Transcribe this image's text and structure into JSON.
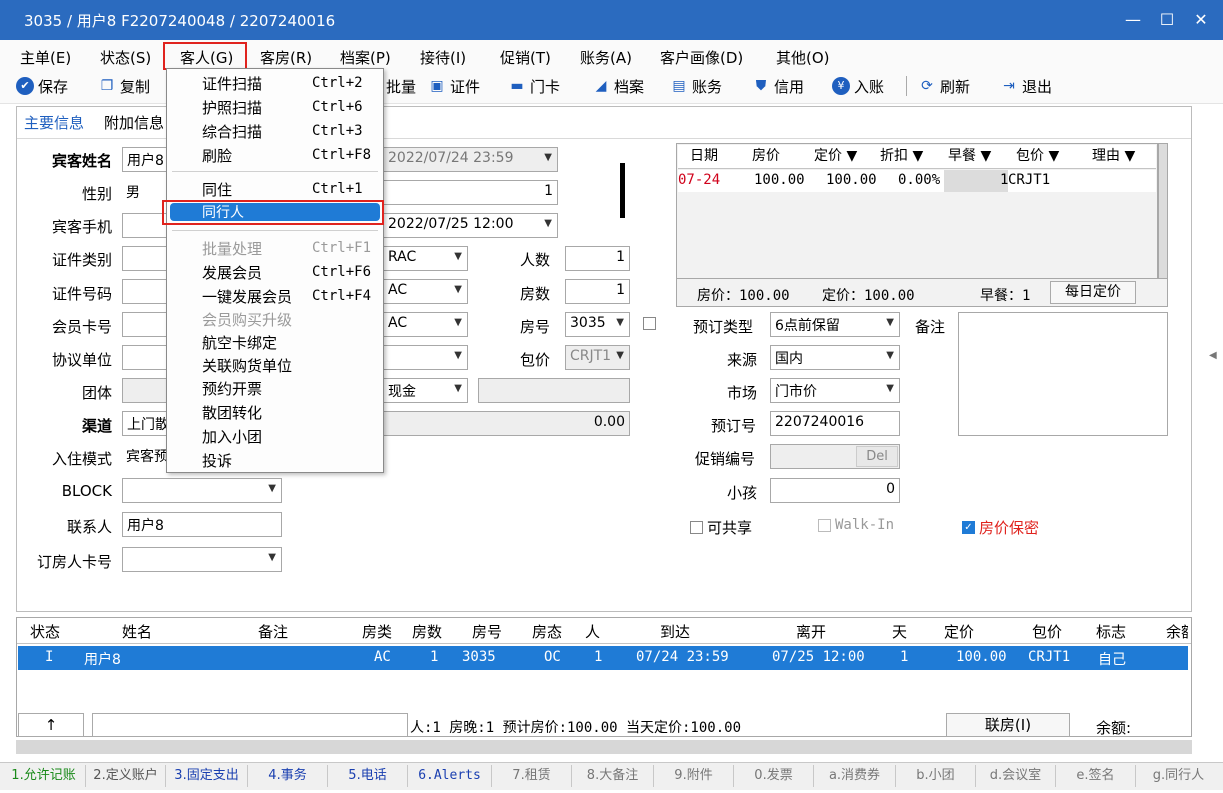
{
  "window": {
    "title": "3035 / 用户8 F2207240048 / 2207240016",
    "controls": {
      "minimize": "—",
      "maximize": "☐",
      "close": "✕"
    }
  },
  "menubar": [
    "主单(E)",
    "状态(S)",
    "客人(G)",
    "客房(R)",
    "档案(P)",
    "接待(I)",
    "促销(T)",
    "账务(A)",
    "客户画像(D)",
    "其他(O)"
  ],
  "toolbar": {
    "save": "保存",
    "copy": "复制",
    "batch": "批量",
    "id": "证件",
    "card": "门卡",
    "profile": "档案",
    "account": "账务",
    "credit": "信用",
    "post": "入账",
    "refresh": "刷新",
    "exit": "退出"
  },
  "subtabs": {
    "main": "主要信息",
    "extra": "附加信息"
  },
  "form_left": {
    "guest_name_label": "宾客姓名",
    "guest_name": "用户8",
    "gender_label": "性别",
    "gender": "男",
    "phone_label": "宾客手机",
    "id_type_label": "证件类别",
    "id_no_label": "证件号码",
    "member_label": "会员卡号",
    "agreement_label": "协议单位",
    "group_label": "团体",
    "channel_label": "渠道",
    "channel": "上门散",
    "checkin_mode_label": "入住模式",
    "checkin_mode": "宾客预",
    "block_label": "BLOCK",
    "contact_label": "联系人",
    "contact": "用户8",
    "booker_card_label": "订房人卡号"
  },
  "form_mid": {
    "arrival": "2022/07/24 23:59",
    "nights": "1",
    "departure": "2022/07/25 12:00",
    "rate_code1": "RAC",
    "rate_code2": "AC",
    "rate_code3": "AC",
    "pay_method": "现金",
    "amount": "0.00",
    "persons_label": "人数",
    "persons": "1",
    "rooms_label": "房数",
    "rooms": "1",
    "room_no_label": "房号",
    "room_no": "3035",
    "package_label": "包价",
    "package": "CRJT1"
  },
  "rate_grid": {
    "headers": [
      "日期",
      "房价",
      "定价 ▼",
      "折扣 ▼",
      "早餐 ▼",
      "包价 ▼",
      "理由 ▼"
    ],
    "row": {
      "date": "07-24",
      "price": "100.00",
      "fixed": "100.00",
      "discount": "0.00%",
      "breakfast": "1",
      "package": "CRJT1"
    },
    "summary": {
      "price": "房价：100.00",
      "fixed": "定价：100.00",
      "breakfast": "早餐：1",
      "daily_button": "每日定价"
    }
  },
  "form_right": {
    "booking_type_label": "预订类型",
    "booking_type": "6点前保留",
    "remark_label": "备注",
    "source_label": "来源",
    "source": "国内",
    "market_label": "市场",
    "market": "门市价",
    "booking_no_label": "预订号",
    "booking_no": "2207240016",
    "promo_label": "促销编号",
    "del_button": "Del",
    "children_label": "小孩",
    "children": "0",
    "shareable": "可共享",
    "walkin": "Walk-In",
    "rate_secret": "房价保密"
  },
  "guest_table": {
    "headers": [
      "状态",
      "姓名",
      "备注",
      "房类",
      "房数",
      "房号",
      "房态",
      "人",
      "到达",
      "离开",
      "天",
      "定价",
      "包价",
      "标志",
      "余额"
    ],
    "row": [
      "I",
      "用户8",
      "",
      "AC",
      "1",
      "3035",
      "OC",
      "1",
      "07/24 23:59",
      "07/25 12:00",
      "1",
      "100.00",
      "CRJT1",
      "自己",
      ""
    ],
    "footer": {
      "up": "↑",
      "summary": "人:1  房晚:1  预计房价:100.00  当天定价:100.00",
      "link_room": "联房(I)",
      "balance": "余额:"
    }
  },
  "status_tabs": [
    "1.允许记账",
    "2.定义账户",
    "3.固定支出",
    "4.事务",
    "5.电话",
    "6.Alerts",
    "7.租赁",
    "8.大备注",
    "9.附件",
    "0.发票",
    "a.消费券",
    "b.小团",
    "d.会议室",
    "e.签名",
    "g.同行人"
  ],
  "dropdown": {
    "items": [
      {
        "label": "证件扫描",
        "key": "Ctrl+2",
        "disabled": false
      },
      {
        "label": "护照扫描",
        "key": "Ctrl+6",
        "disabled": false
      },
      {
        "label": "综合扫描",
        "key": "Ctrl+3",
        "disabled": false
      },
      {
        "label": "刷脸",
        "key": "Ctrl+F8",
        "disabled": false
      },
      {
        "label": "同住",
        "key": "Ctrl+1",
        "disabled": false
      },
      {
        "label": "同行人",
        "key": "",
        "disabled": false,
        "selected": true
      },
      {
        "label": "批量处理",
        "key": "Ctrl+F1",
        "disabled": true
      },
      {
        "label": "发展会员",
        "key": "Ctrl+F6",
        "disabled": false
      },
      {
        "label": "一键发展会员",
        "key": "Ctrl+F4",
        "disabled": false
      },
      {
        "label": "会员购买升级",
        "key": "",
        "disabled": true
      },
      {
        "label": "航空卡绑定",
        "key": "",
        "disabled": false
      },
      {
        "label": "关联购货单位",
        "key": "",
        "disabled": false
      },
      {
        "label": "预约开票",
        "key": "",
        "disabled": false
      },
      {
        "label": "散团转化",
        "key": "",
        "disabled": false
      },
      {
        "label": "加入小团",
        "key": "",
        "disabled": false
      },
      {
        "label": "投诉",
        "key": "",
        "disabled": false
      }
    ]
  },
  "colors": {
    "titlebar": "#2b6bbf",
    "selection": "#1f7bd6",
    "highlight_box": "#e0231e",
    "secret_text": "#e0231e"
  }
}
